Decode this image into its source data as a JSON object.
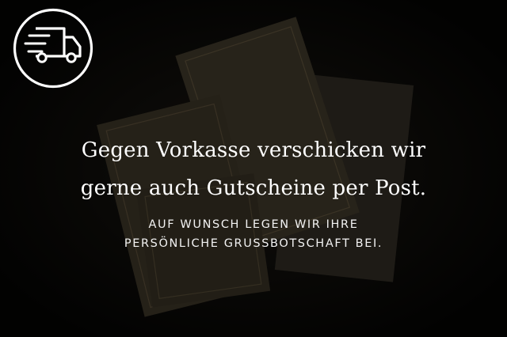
{
  "icon": {
    "name": "delivery-truck-icon",
    "color": "#ffffff"
  },
  "headline": {
    "line1": "Gegen Vorkasse verschicken wir",
    "line2": "gerne auch Gutscheine per Post."
  },
  "subline": {
    "line1": "AUF WUNSCH LEGEN WIR IHRE",
    "line2": "PERSÖNLICHE GRUSSBOTSCHAFT BEI."
  },
  "background": {
    "description_colors": {
      "base": "#060605",
      "card": "#3a3326"
    }
  }
}
